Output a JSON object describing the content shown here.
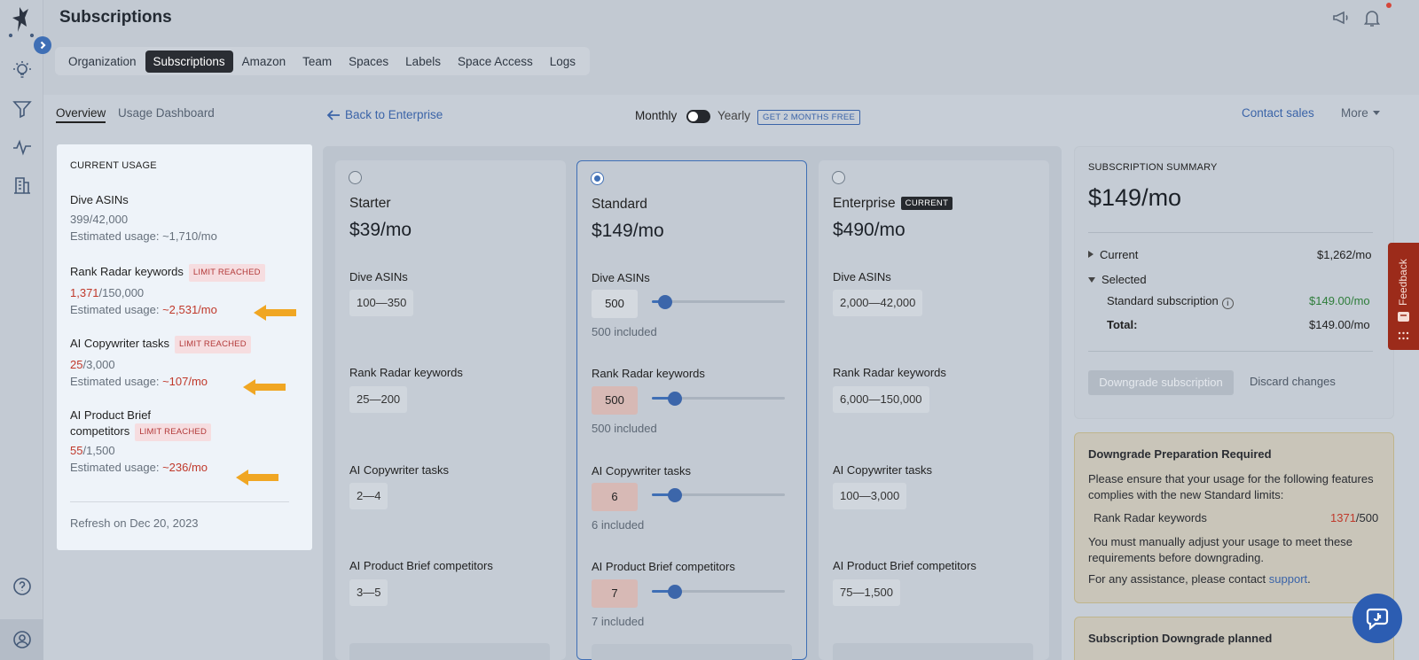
{
  "app": {
    "title": "Subscriptions"
  },
  "tabs": [
    {
      "label": "Organization"
    },
    {
      "label": "Subscriptions",
      "active": true
    },
    {
      "label": "Amazon"
    },
    {
      "label": "Team"
    },
    {
      "label": "Spaces"
    },
    {
      "label": "Labels"
    },
    {
      "label": "Space Access"
    },
    {
      "label": "Logs"
    }
  ],
  "subnav": {
    "overview": "Overview",
    "usage_dashboard": "Usage Dashboard",
    "back_link": "Back to Enterprise",
    "monthly": "Monthly",
    "yearly": "Yearly",
    "promo": "GET 2 MONTHS FREE",
    "contact_sales": "Contact sales",
    "more": "More"
  },
  "current_usage": {
    "heading": "CURRENT USAGE",
    "limit_badge": "LIMIT REACHED",
    "items": [
      {
        "name": "Dive ASINs",
        "used": "399",
        "limit": "/42,000",
        "est_label": "Estimated usage: ",
        "est_value": "~1,710/mo",
        "limit_reached": false
      },
      {
        "name": "Rank Radar keywords",
        "used": "1,371",
        "limit": "/150,000",
        "est_label": "Estimated usage: ",
        "est_value": "~2,531/mo",
        "limit_reached": true
      },
      {
        "name": "AI Copywriter tasks",
        "used": "25",
        "limit": "/3,000",
        "est_label": "Estimated usage: ",
        "est_value": "~107/mo",
        "limit_reached": true
      },
      {
        "name_line1": "AI Product Brief",
        "name_line2": "competitors",
        "used": "55",
        "limit": "/1,500",
        "est_label": "Estimated usage: ",
        "est_value": "~236/mo",
        "limit_reached": true
      }
    ],
    "refresh": "Refresh on Dec 20, 2023"
  },
  "plans": [
    {
      "name": "Starter",
      "price": "$39/mo",
      "selected": false,
      "features": [
        {
          "label": "Dive ASINs",
          "range": "100—350"
        },
        {
          "label": "Rank Radar keywords",
          "range": "25—200"
        },
        {
          "label": "AI Copywriter tasks",
          "range": "2—4"
        },
        {
          "label": "AI Product Brief competitors",
          "range": "3—5"
        }
      ]
    },
    {
      "name": "Standard",
      "price": "$149/mo",
      "selected": true,
      "features": [
        {
          "label": "Dive ASINs",
          "value": "500",
          "included": "500 included",
          "level": 0.1
        },
        {
          "label": "Rank Radar keywords",
          "value": "500",
          "included": "500 included",
          "level": 0.17
        },
        {
          "label": "AI Copywriter tasks",
          "value": "6",
          "included": "6 included",
          "level": 0.17
        },
        {
          "label": "AI Product Brief competitors",
          "value": "7",
          "included": "7 included",
          "level": 0.17
        }
      ]
    },
    {
      "name": "Enterprise",
      "badge": "CURRENT",
      "price": "$490/mo",
      "selected": false,
      "features": [
        {
          "label": "Dive ASINs",
          "range": "2,000—42,000"
        },
        {
          "label": "Rank Radar keywords",
          "range": "6,000—150,000"
        },
        {
          "label": "AI Copywriter tasks",
          "range": "100—3,000"
        },
        {
          "label": "AI Product Brief competitors",
          "range": "75—1,500"
        }
      ]
    }
  ],
  "summary": {
    "heading": "SUBSCRIPTION SUMMARY",
    "price": "$149/mo",
    "current_label": "Current",
    "current_value": "$1,262/mo",
    "selected_label": "Selected",
    "standard_label": "Standard subscription",
    "standard_value": "$149.00/mo",
    "total_label": "Total:",
    "total_value": "$149.00/mo",
    "downgrade_button": "Downgrade subscription",
    "discard_button": "Discard changes"
  },
  "downgrade_prep": {
    "title": "Downgrade Preparation Required",
    "line1": "Please ensure that your usage for the following features",
    "line2": "complies with the new Standard limits:",
    "feature": "Rank Radar keywords",
    "usage": "1371",
    "limit": "/500",
    "line3": "You must manually adjust your usage to meet these",
    "line4": "requirements before downgrading.",
    "line5": "For any assistance, please contact ",
    "support": "support",
    "period": "."
  },
  "downgrade_planned": {
    "title": "Subscription Downgrade planned"
  },
  "feedback": {
    "label": "Feedback"
  },
  "colors": {
    "accent": "#3f6fb5",
    "limit": "#c0392b",
    "success": "#2e7d3a",
    "arrow": "#f0a623"
  }
}
